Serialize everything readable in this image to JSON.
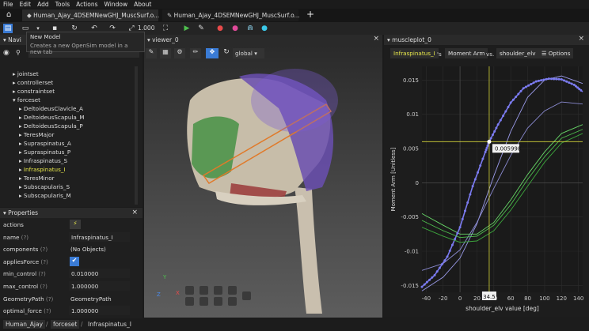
{
  "menu": [
    "File",
    "Edit",
    "Add",
    "Tools",
    "Actions",
    "Window",
    "About"
  ],
  "tabs": [
    {
      "label": "Human_Ajay_4DSEMNewGHJ_MuscSurf.o...",
      "active": true
    },
    {
      "label": "Human_Ajay_4DSEMNewGHJ_MuscSurf.o...",
      "active": false
    }
  ],
  "toolbar": {
    "speed": "1.000"
  },
  "tooltip": {
    "title": "New Model",
    "body": "Creates a new OpenSim model in a new tab"
  },
  "navigator": {
    "title": "Navi",
    "items": [
      {
        "label": "jointset",
        "level": 1,
        "type": "arrow"
      },
      {
        "label": "controllerset",
        "level": 1,
        "type": "arrow"
      },
      {
        "label": "constraintset",
        "level": 1,
        "type": "arrow"
      },
      {
        "label": "forceset",
        "level": 1,
        "type": "open"
      },
      {
        "label": "DeltoideusClavicle_A",
        "level": 2,
        "type": "arrow"
      },
      {
        "label": "DeltoideusScapula_M",
        "level": 2,
        "type": "arrow"
      },
      {
        "label": "DeltoideusScapula_P",
        "level": 2,
        "type": "arrow"
      },
      {
        "label": "TeresMajor",
        "level": 2,
        "type": "arrow"
      },
      {
        "label": "Supraspinatus_A",
        "level": 2,
        "type": "arrow"
      },
      {
        "label": "Supraspinatus_P",
        "level": 2,
        "type": "arrow"
      },
      {
        "label": "Infraspinatus_S",
        "level": 2,
        "type": "arrow"
      },
      {
        "label": "Infraspinatus_I",
        "level": 2,
        "type": "arrow",
        "selected": true
      },
      {
        "label": "TeresMinor",
        "level": 2,
        "type": "arrow"
      },
      {
        "label": "Subscapularis_S",
        "level": 2,
        "type": "arrow"
      },
      {
        "label": "Subscapularis_M",
        "level": 2,
        "type": "arrow"
      }
    ]
  },
  "properties": {
    "title": "Properties",
    "rows": [
      {
        "label": "actions",
        "help": "",
        "value": "⚡",
        "kind": "action"
      },
      {
        "label": "name",
        "help": "(?)",
        "value": "Infraspinatus_I",
        "kind": "field"
      },
      {
        "label": "components",
        "help": "(?)",
        "value": "(No Objects)",
        "kind": "text"
      },
      {
        "label": "appliesForce",
        "help": "(?)",
        "value": "✔",
        "kind": "check"
      },
      {
        "label": "min_control",
        "help": "(?)",
        "value": "0.010000",
        "kind": "field"
      },
      {
        "label": "max_control",
        "help": "(?)",
        "value": "1.000000",
        "kind": "field"
      },
      {
        "label": "GeometryPath",
        "help": "(?)",
        "value": "GeometryPath",
        "kind": "text"
      },
      {
        "label": "optimal_force",
        "help": "(?)",
        "value": "1.000000",
        "kind": "field"
      }
    ]
  },
  "viewer": {
    "title": "viewer_0",
    "frame": "global"
  },
  "plot": {
    "title": "muscleplot_0",
    "muscle": "Infraspinatus_I",
    "apostrophe": "'s",
    "output": "Moment Arm",
    "vs": "vs.",
    "coord": "shoulder_elv",
    "options": "Options",
    "readout": "0.005998",
    "xmarker": "34.5"
  },
  "chart_data": {
    "type": "line",
    "xlabel": "shoulder_elv value [deg]",
    "ylabel": "Moment Arm [Unitless]",
    "xlim": [
      -45,
      145
    ],
    "ylim": [
      -0.016,
      0.017
    ],
    "xticks": [
      -40,
      -20,
      0,
      20,
      40,
      60,
      80,
      100,
      120,
      140
    ],
    "yticks": [
      0.015,
      0.01,
      0.005,
      0,
      -0.005,
      -0.01,
      -0.015
    ],
    "ytick_labels": [
      "0.015",
      "0.01",
      "0.005",
      "0",
      "-0.005",
      "-0.01",
      "-0.015"
    ],
    "series": [
      {
        "color": "#7b7bf0",
        "x": [
          -45,
          -30,
          -15,
          0,
          15,
          30,
          34.5,
          45,
          60,
          75,
          90,
          105,
          120,
          135,
          145
        ],
        "y": [
          -0.0152,
          -0.0135,
          -0.0108,
          -0.0065,
          -0.0005,
          0.0045,
          0.006,
          0.0085,
          0.0117,
          0.0138,
          0.0148,
          0.0152,
          0.0151,
          0.0143,
          0.0133
        ]
      },
      {
        "color": "#9a9ae8",
        "x": [
          -45,
          -20,
          0,
          20,
          40,
          60,
          80,
          100,
          120,
          145
        ],
        "y": [
          -0.0158,
          -0.0138,
          -0.011,
          -0.006,
          0.001,
          0.0075,
          0.0125,
          0.015,
          0.0156,
          0.0145
        ]
      },
      {
        "color": "#8a8ad0",
        "x": [
          -45,
          -20,
          0,
          20,
          40,
          60,
          80,
          100,
          120,
          145
        ],
        "y": [
          -0.0128,
          -0.0118,
          -0.0098,
          -0.0058,
          -0.0008,
          0.004,
          0.008,
          0.0105,
          0.0118,
          0.0115
        ]
      },
      {
        "color": "#66d466",
        "x": [
          -45,
          -20,
          0,
          20,
          40,
          60,
          80,
          100,
          120,
          145
        ],
        "y": [
          -0.0045,
          -0.0062,
          -0.0075,
          -0.0075,
          -0.0058,
          -0.0025,
          0.0012,
          0.0045,
          0.0072,
          0.0085
        ]
      },
      {
        "color": "#4ec04e",
        "x": [
          -45,
          -20,
          0,
          20,
          40,
          60,
          80,
          100,
          120,
          145
        ],
        "y": [
          -0.0055,
          -0.007,
          -0.008,
          -0.0078,
          -0.0062,
          -0.0032,
          0.0005,
          0.0038,
          0.0065,
          0.0078
        ]
      },
      {
        "color": "#3da63d",
        "x": [
          -45,
          -20,
          0,
          20,
          40,
          60,
          80,
          100,
          120,
          145
        ],
        "y": [
          -0.0065,
          -0.0078,
          -0.0087,
          -0.0085,
          -0.007,
          -0.004,
          -0.0005,
          0.003,
          0.0058,
          0.0072
        ]
      }
    ],
    "hline": {
      "y": 0.006,
      "color": "#d8d83a"
    },
    "vline": {
      "x": 34.5,
      "color": "#d8d83a"
    },
    "marker": {
      "x": 34.5,
      "y": 0.006
    }
  },
  "status": {
    "crumbs": [
      "Human_Ajay",
      "forceset",
      "Infraspinatus_I"
    ]
  },
  "colors": {
    "accent": "#3a7bd5",
    "selected": "#e8e84a",
    "bg": "#1b1b1b"
  }
}
